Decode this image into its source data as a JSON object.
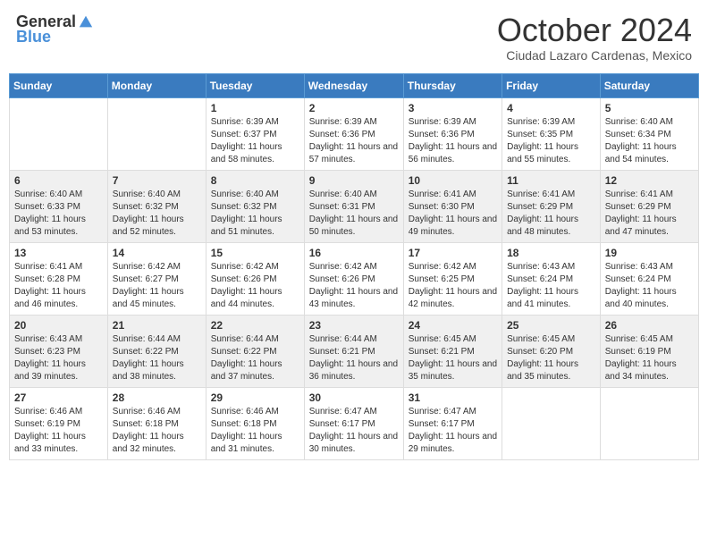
{
  "header": {
    "logo_general": "General",
    "logo_blue": "Blue",
    "month_title": "October 2024",
    "location": "Ciudad Lazaro Cardenas, Mexico"
  },
  "days_of_week": [
    "Sunday",
    "Monday",
    "Tuesday",
    "Wednesday",
    "Thursday",
    "Friday",
    "Saturday"
  ],
  "weeks": [
    [
      {
        "day": "",
        "content": ""
      },
      {
        "day": "",
        "content": ""
      },
      {
        "day": "1",
        "content": "Sunrise: 6:39 AM\nSunset: 6:37 PM\nDaylight: 11 hours and 58 minutes."
      },
      {
        "day": "2",
        "content": "Sunrise: 6:39 AM\nSunset: 6:36 PM\nDaylight: 11 hours and 57 minutes."
      },
      {
        "day": "3",
        "content": "Sunrise: 6:39 AM\nSunset: 6:36 PM\nDaylight: 11 hours and 56 minutes."
      },
      {
        "day": "4",
        "content": "Sunrise: 6:39 AM\nSunset: 6:35 PM\nDaylight: 11 hours and 55 minutes."
      },
      {
        "day": "5",
        "content": "Sunrise: 6:40 AM\nSunset: 6:34 PM\nDaylight: 11 hours and 54 minutes."
      }
    ],
    [
      {
        "day": "6",
        "content": "Sunrise: 6:40 AM\nSunset: 6:33 PM\nDaylight: 11 hours and 53 minutes."
      },
      {
        "day": "7",
        "content": "Sunrise: 6:40 AM\nSunset: 6:32 PM\nDaylight: 11 hours and 52 minutes."
      },
      {
        "day": "8",
        "content": "Sunrise: 6:40 AM\nSunset: 6:32 PM\nDaylight: 11 hours and 51 minutes."
      },
      {
        "day": "9",
        "content": "Sunrise: 6:40 AM\nSunset: 6:31 PM\nDaylight: 11 hours and 50 minutes."
      },
      {
        "day": "10",
        "content": "Sunrise: 6:41 AM\nSunset: 6:30 PM\nDaylight: 11 hours and 49 minutes."
      },
      {
        "day": "11",
        "content": "Sunrise: 6:41 AM\nSunset: 6:29 PM\nDaylight: 11 hours and 48 minutes."
      },
      {
        "day": "12",
        "content": "Sunrise: 6:41 AM\nSunset: 6:29 PM\nDaylight: 11 hours and 47 minutes."
      }
    ],
    [
      {
        "day": "13",
        "content": "Sunrise: 6:41 AM\nSunset: 6:28 PM\nDaylight: 11 hours and 46 minutes."
      },
      {
        "day": "14",
        "content": "Sunrise: 6:42 AM\nSunset: 6:27 PM\nDaylight: 11 hours and 45 minutes."
      },
      {
        "day": "15",
        "content": "Sunrise: 6:42 AM\nSunset: 6:26 PM\nDaylight: 11 hours and 44 minutes."
      },
      {
        "day": "16",
        "content": "Sunrise: 6:42 AM\nSunset: 6:26 PM\nDaylight: 11 hours and 43 minutes."
      },
      {
        "day": "17",
        "content": "Sunrise: 6:42 AM\nSunset: 6:25 PM\nDaylight: 11 hours and 42 minutes."
      },
      {
        "day": "18",
        "content": "Sunrise: 6:43 AM\nSunset: 6:24 PM\nDaylight: 11 hours and 41 minutes."
      },
      {
        "day": "19",
        "content": "Sunrise: 6:43 AM\nSunset: 6:24 PM\nDaylight: 11 hours and 40 minutes."
      }
    ],
    [
      {
        "day": "20",
        "content": "Sunrise: 6:43 AM\nSunset: 6:23 PM\nDaylight: 11 hours and 39 minutes."
      },
      {
        "day": "21",
        "content": "Sunrise: 6:44 AM\nSunset: 6:22 PM\nDaylight: 11 hours and 38 minutes."
      },
      {
        "day": "22",
        "content": "Sunrise: 6:44 AM\nSunset: 6:22 PM\nDaylight: 11 hours and 37 minutes."
      },
      {
        "day": "23",
        "content": "Sunrise: 6:44 AM\nSunset: 6:21 PM\nDaylight: 11 hours and 36 minutes."
      },
      {
        "day": "24",
        "content": "Sunrise: 6:45 AM\nSunset: 6:21 PM\nDaylight: 11 hours and 35 minutes."
      },
      {
        "day": "25",
        "content": "Sunrise: 6:45 AM\nSunset: 6:20 PM\nDaylight: 11 hours and 35 minutes."
      },
      {
        "day": "26",
        "content": "Sunrise: 6:45 AM\nSunset: 6:19 PM\nDaylight: 11 hours and 34 minutes."
      }
    ],
    [
      {
        "day": "27",
        "content": "Sunrise: 6:46 AM\nSunset: 6:19 PM\nDaylight: 11 hours and 33 minutes."
      },
      {
        "day": "28",
        "content": "Sunrise: 6:46 AM\nSunset: 6:18 PM\nDaylight: 11 hours and 32 minutes."
      },
      {
        "day": "29",
        "content": "Sunrise: 6:46 AM\nSunset: 6:18 PM\nDaylight: 11 hours and 31 minutes."
      },
      {
        "day": "30",
        "content": "Sunrise: 6:47 AM\nSunset: 6:17 PM\nDaylight: 11 hours and 30 minutes."
      },
      {
        "day": "31",
        "content": "Sunrise: 6:47 AM\nSunset: 6:17 PM\nDaylight: 11 hours and 29 minutes."
      },
      {
        "day": "",
        "content": ""
      },
      {
        "day": "",
        "content": ""
      }
    ]
  ]
}
